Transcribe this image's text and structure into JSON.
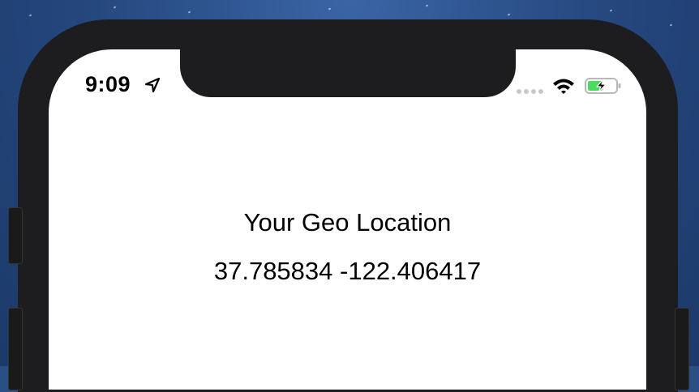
{
  "status_bar": {
    "time": "9:09",
    "location_icon": "location-arrow-icon",
    "signal_icon": "cellular-signal-icon",
    "wifi_icon": "wifi-icon",
    "battery_icon": "battery-charging-icon",
    "battery_color": "#4cd964"
  },
  "main": {
    "title": "Your Geo Location",
    "coordinates": "37.785834 -122.406417"
  }
}
